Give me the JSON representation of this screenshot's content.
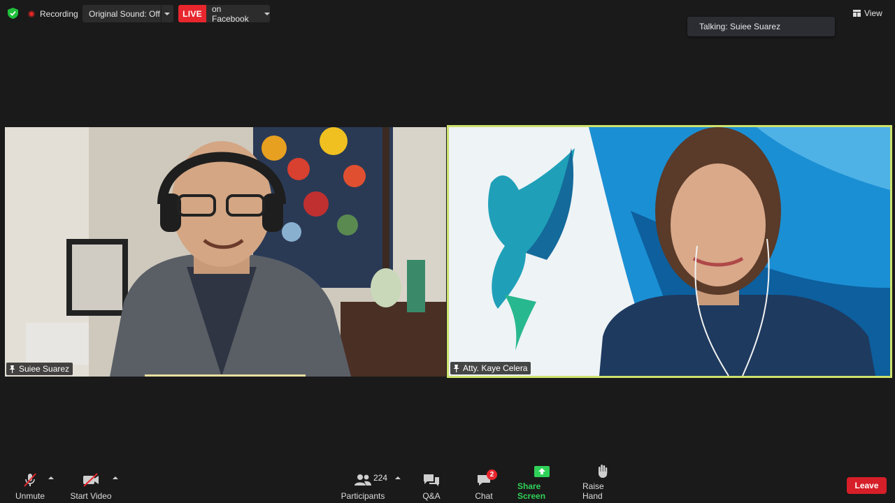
{
  "topbar": {
    "recording_label": "Recording",
    "original_sound_label": "Original Sound: Off",
    "live_badge": "LIVE",
    "live_target": "on Facebook",
    "talking_label": "Talking: Suiee Suarez",
    "view_label": "View"
  },
  "participants": [
    {
      "name": "Suiee Suarez",
      "pinned": true
    },
    {
      "name": "Atty. Kaye Celera",
      "pinned": true,
      "active_speaker_highlight": true
    }
  ],
  "toolbar": {
    "unmute": "Unmute",
    "start_video": "Start Video",
    "participants": "Participants",
    "participants_count": "224",
    "qa": "Q&A",
    "chat": "Chat",
    "chat_badge": "2",
    "share_screen": "Share Screen",
    "raise_hand": "Raise Hand",
    "leave": "Leave"
  },
  "colors": {
    "background": "#1a1a1a",
    "live_red": "#e8262d",
    "active_speaker_border": "#cde26c",
    "share_green": "#30d158",
    "leave_red": "#d61f28"
  },
  "icons": [
    "shield-icon",
    "recording-dot-icon",
    "view-grid-icon",
    "pin-icon",
    "mic-muted-icon",
    "video-off-icon",
    "participants-icon",
    "qa-icon",
    "chat-icon",
    "share-screen-icon",
    "raise-hand-icon"
  ]
}
